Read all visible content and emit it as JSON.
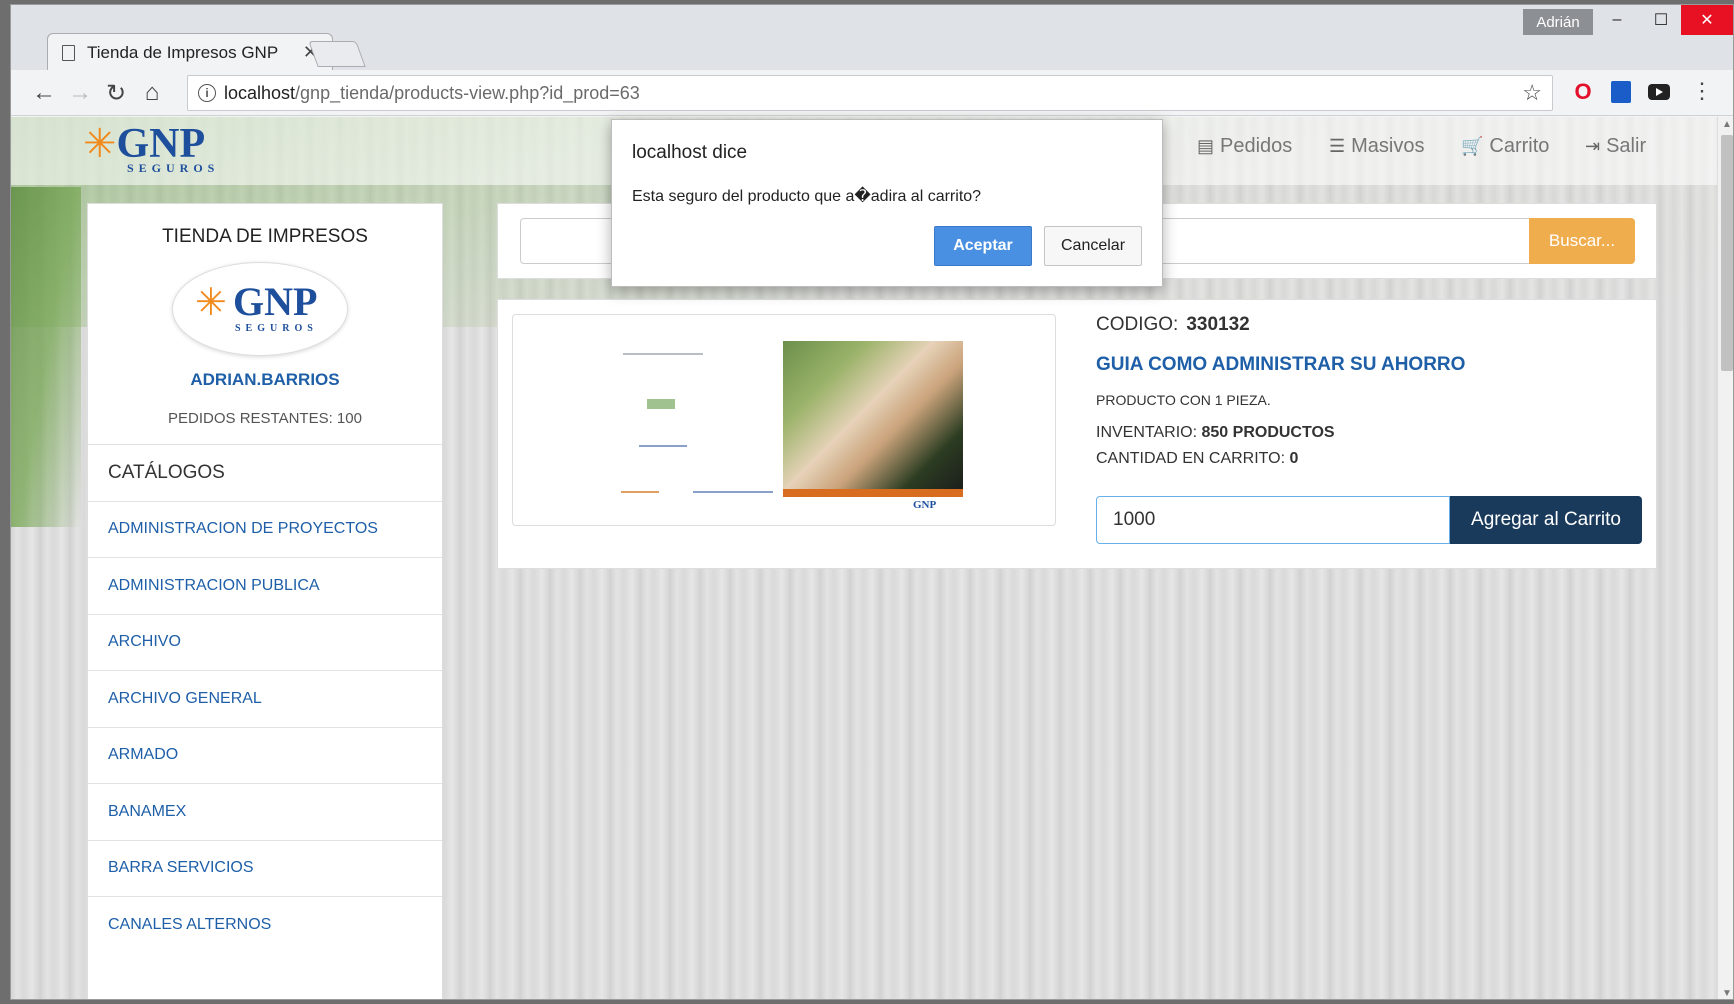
{
  "window": {
    "tab_title": "Tienda de Impresos GNP",
    "tab_close": "✕",
    "profile_name": "Adrián",
    "min_label": "–",
    "max_label": "☐",
    "close_label": "✕"
  },
  "toolbar": {
    "url_host": "localhost",
    "url_path": "/gnp_tienda/products-view.php?id_prod=63",
    "back": "←",
    "forward": "→",
    "reload": "↻",
    "home": "⌂",
    "star": "☆",
    "menu": "⋮",
    "info": "i",
    "opera": "O"
  },
  "brand": {
    "name": "GNP",
    "sub": "SEGUROS",
    "star": "✳"
  },
  "navbar": {
    "links": [
      {
        "label": "Pedidos",
        "icon": "▤"
      },
      {
        "label": "Masivos",
        "icon": "☰"
      },
      {
        "label": "Carrito",
        "icon": "🛒"
      },
      {
        "label": "Salir",
        "icon": "⇥"
      }
    ]
  },
  "sidebar": {
    "title": "TIENDA DE IMPRESOS",
    "user": "ADRIAN.BARRIOS",
    "remaining": "PEDIDOS RESTANTES: 100",
    "catalog_header": "CATÁLOGOS",
    "items": [
      "ADMINISTRACION DE PROYECTOS",
      "ADMINISTRACION PUBLICA",
      "ARCHIVO",
      "ARCHIVO GENERAL",
      "ARMADO",
      "BANAMEX",
      "BARRA SERVICIOS",
      "CANALES ALTERNOS"
    ]
  },
  "search": {
    "button": "Buscar..."
  },
  "product": {
    "code_label": "CODIGO:",
    "code": "330132",
    "name": "GUIA COMO ADMINISTRAR SU AHORRO",
    "pieces": "PRODUCTO CON 1 PIEZA.",
    "inventory_label": "INVENTARIO:",
    "inventory": "850 PRODUCTOS",
    "cart_label": "CANTIDAD EN CARRITO:",
    "cart": "0",
    "quantity": "1000",
    "add_button": "Agregar al Carrito",
    "thumb_brand": "GNP"
  },
  "dialog": {
    "title": "localhost dice",
    "message": "Esta seguro del producto que a�adira al carrito?",
    "ok": "Aceptar",
    "cancel": "Cancelar"
  },
  "scrollbar": {
    "up": "▲",
    "down": "▼"
  }
}
